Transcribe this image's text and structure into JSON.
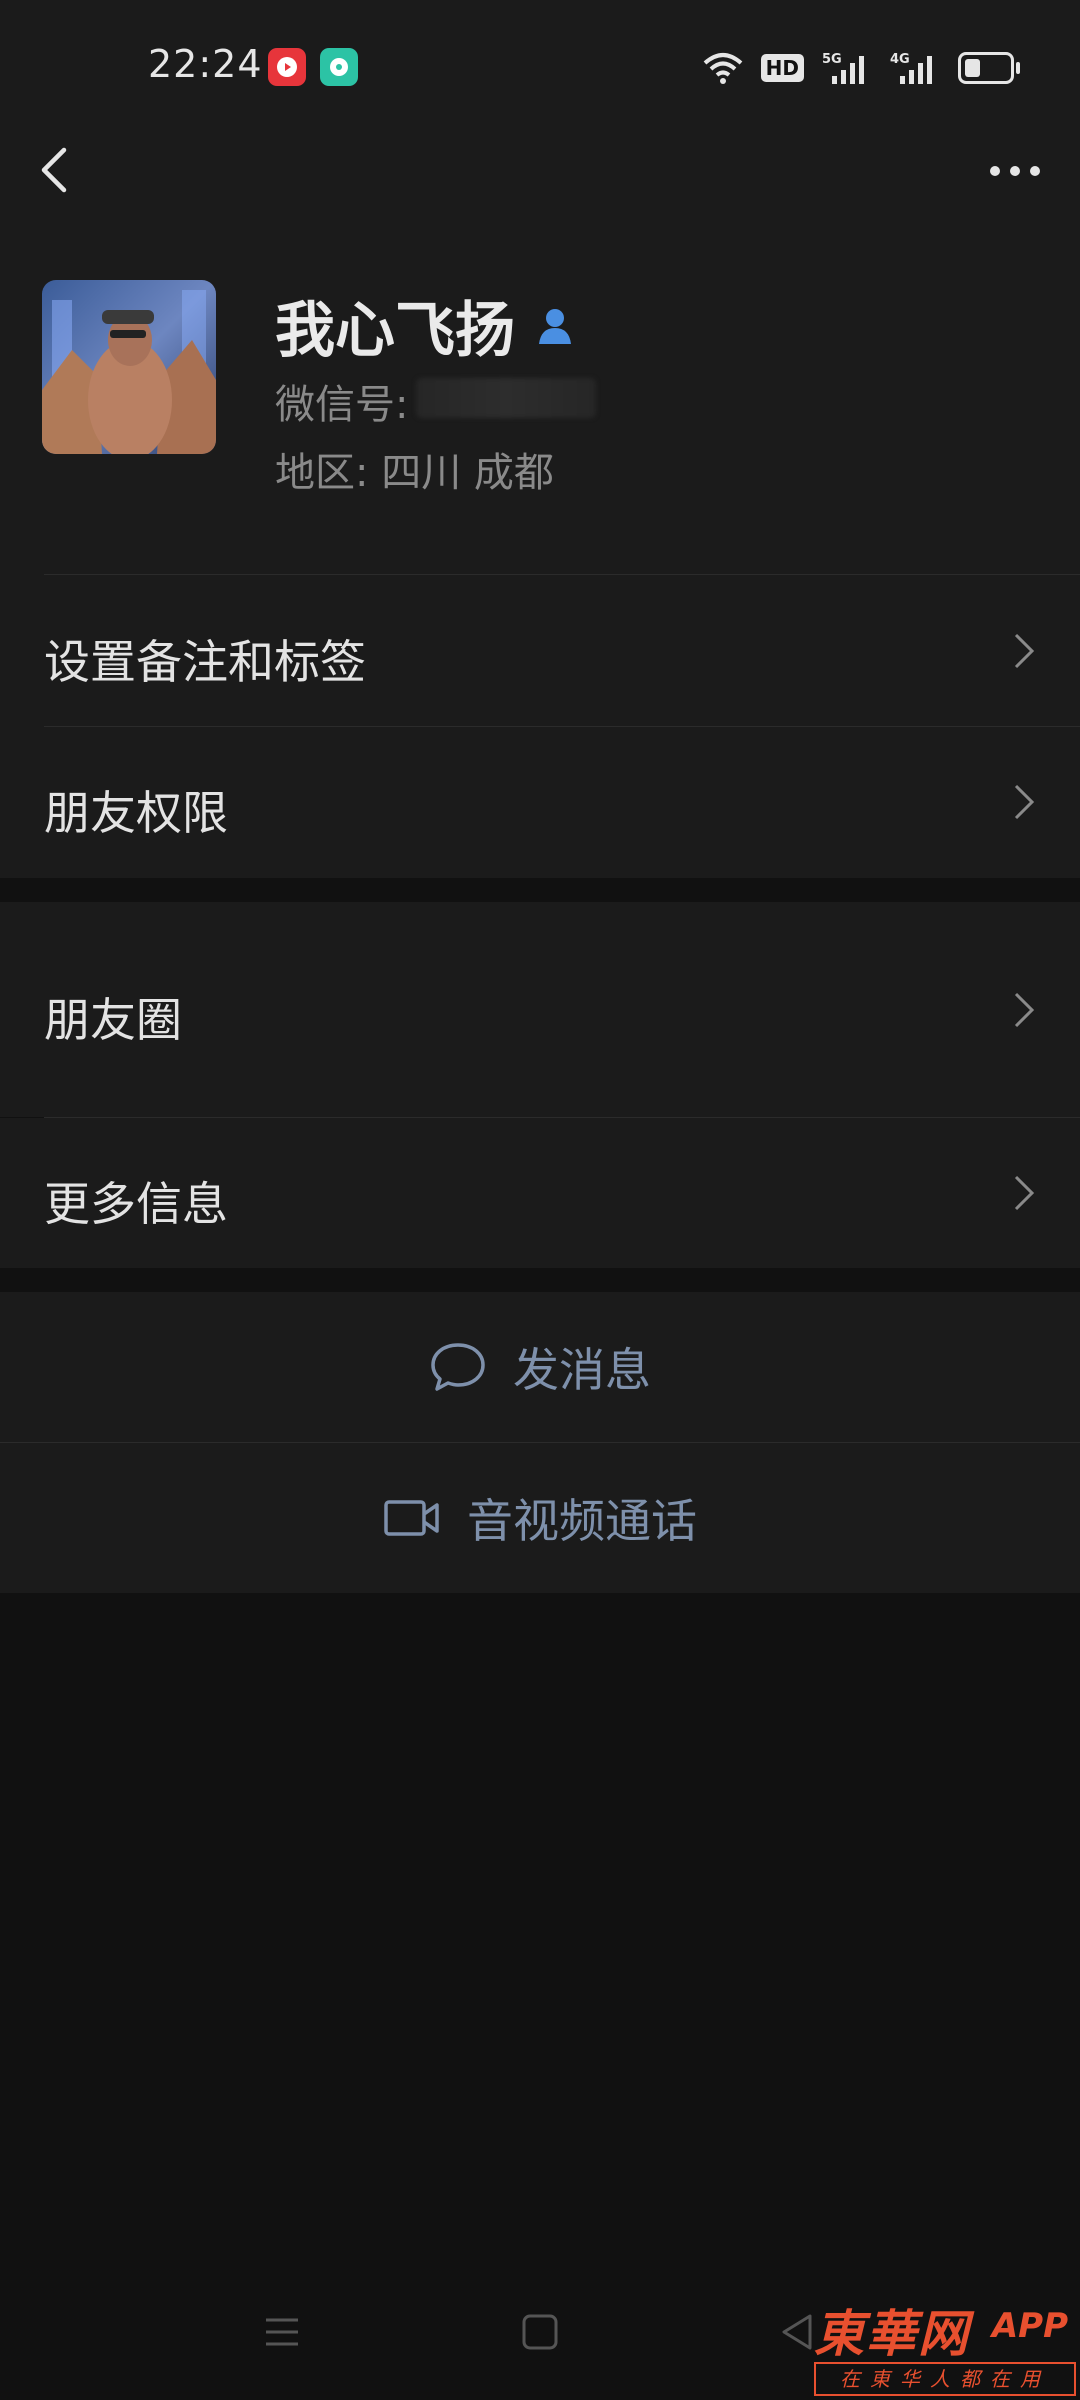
{
  "status_bar": {
    "time": "22:24",
    "hd_label": "HD",
    "network_labels": [
      "5G",
      "4G"
    ],
    "battery_level": 0.35
  },
  "nav": {
    "back_icon": "chevron-left-icon",
    "more_icon": "more-dots-icon"
  },
  "profile": {
    "name": "我心飞扬",
    "wechat_id_label": "微信号:",
    "region": "地区:  四川  成都",
    "avatar_description_icon": "avatar-photo",
    "contact_badge_color": "#4a8fe2"
  },
  "menu": {
    "items": [
      {
        "label": "设置备注和标签"
      },
      {
        "label": "朋友权限"
      },
      {
        "label": "朋友圈"
      },
      {
        "label": "更多信息"
      }
    ]
  },
  "actions": {
    "send_message": "发消息",
    "av_call": "音视频通话",
    "accent_color": "#7e90ab"
  },
  "watermark": {
    "title": "東華网",
    "app": "APP",
    "subtitle": "在東华人都在用"
  }
}
